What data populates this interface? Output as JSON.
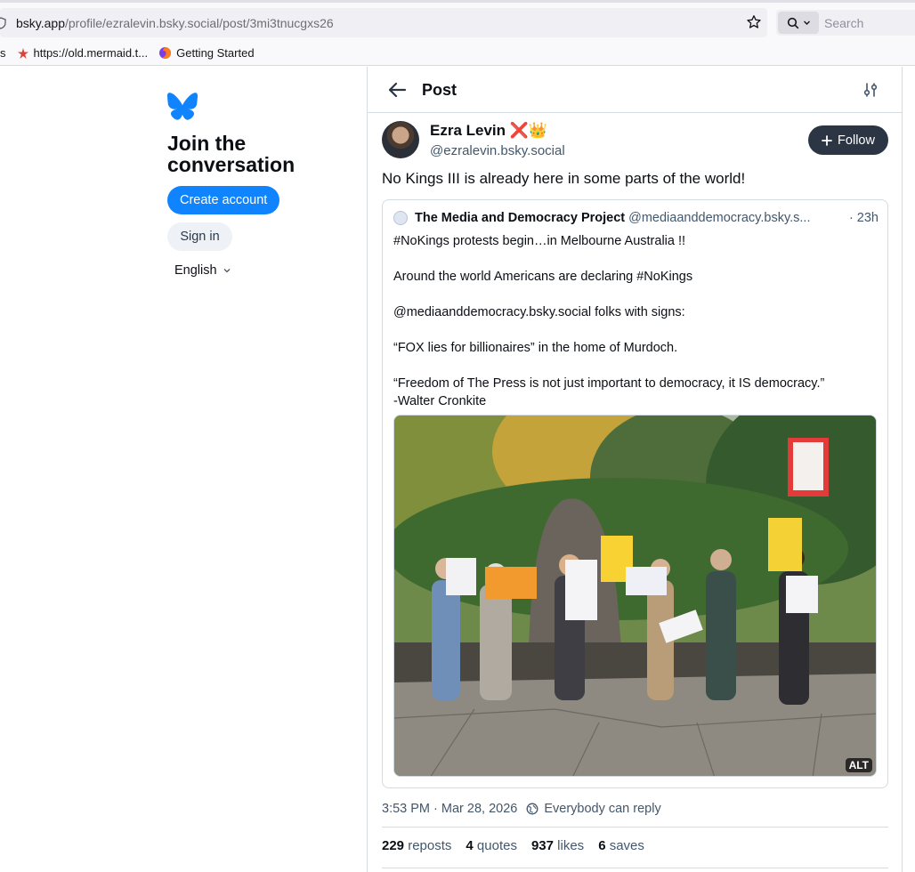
{
  "browser": {
    "url_host": "bsky.app",
    "url_path": "/profile/ezralevin.bsky.social/post/3mi3tnucgxs26",
    "search_placeholder": "Search",
    "bookmarks": [
      {
        "label": "s",
        "icon": "truncated-bookmark"
      },
      {
        "label": "https://old.mermaid.t...",
        "icon": "mermaid-icon"
      },
      {
        "label": "Getting Started",
        "icon": "firefox-icon"
      }
    ]
  },
  "sidebar": {
    "title": "Join the conversation",
    "create_account": "Create account",
    "sign_in": "Sign in",
    "language": "English"
  },
  "header": {
    "title": "Post"
  },
  "post": {
    "author_name": "Ezra Levin ❌👑",
    "author_handle": "@ezralevin.bsky.social",
    "follow_label": "Follow",
    "text": "No Kings III is already here in some parts of the world!",
    "quote": {
      "name": "The Media and Democracy Project",
      "handle": "@mediaanddemocracy.bsky.s...",
      "time": "· 23h",
      "lines": [
        "#NoKings protests begin…in Melbourne Australia !!",
        "",
        "Around the world Americans are declaring #NoKings",
        "",
        "@mediaanddemocracy.bsky.social folks with signs:",
        "",
        "“FOX lies for billionaires” in the home of Murdoch.",
        "",
        "“Freedom of The Press is not just important to democracy, it IS democracy.”",
        "-Walter Cronkite"
      ],
      "image_alt_badge": "ALT"
    },
    "timestamp": "3:53 PM · Mar 28, 2026",
    "reply_setting": "Everybody can reply",
    "stats": [
      {
        "count": "229",
        "label": "reposts"
      },
      {
        "count": "4",
        "label": "quotes"
      },
      {
        "count": "937",
        "label": "likes"
      },
      {
        "count": "6",
        "label": "saves"
      }
    ]
  },
  "colors": {
    "brand_blue": "#1083fe",
    "follow_bg": "#2b3543",
    "muted_text": "#42576c",
    "border": "#d4dbe2"
  }
}
